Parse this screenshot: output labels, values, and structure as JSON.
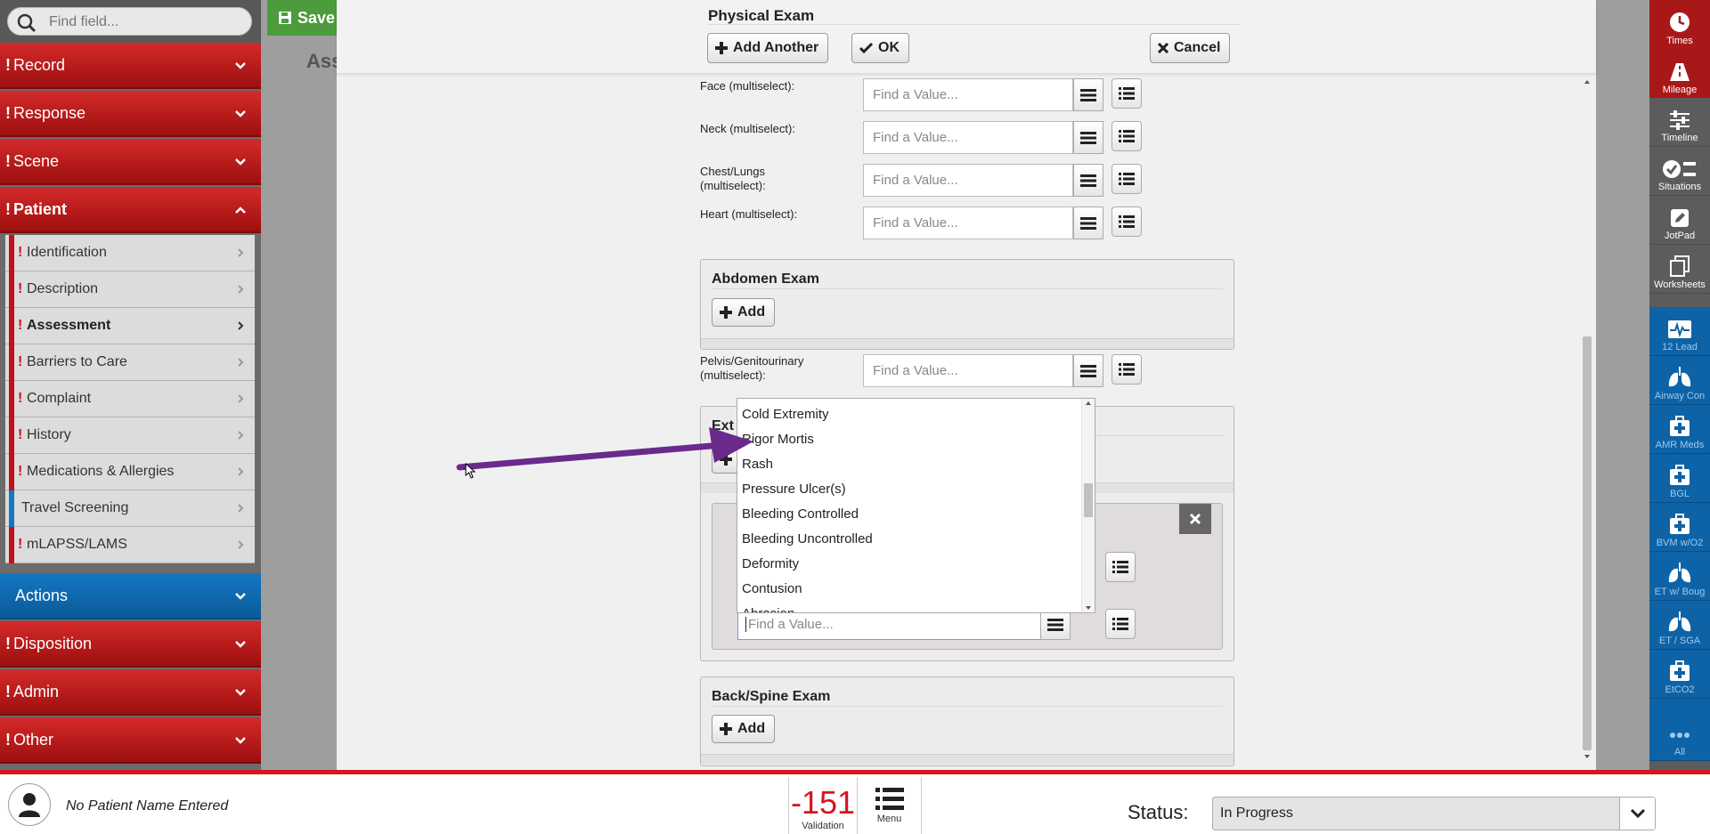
{
  "sidebar": {
    "search_placeholder": "Find field...",
    "sections": [
      {
        "label": "Record",
        "required": true
      },
      {
        "label": "Response",
        "required": true
      },
      {
        "label": "Scene",
        "required": true
      },
      {
        "label": "Patient",
        "required": true,
        "expanded": true
      }
    ],
    "patient_items": [
      {
        "label": "Identification",
        "required": true
      },
      {
        "label": "Description",
        "required": true
      },
      {
        "label": "Assessment",
        "required": true,
        "active": true
      },
      {
        "label": "Barriers to Care",
        "required": true
      },
      {
        "label": "Complaint",
        "required": true
      },
      {
        "label": "History",
        "required": true
      },
      {
        "label": "Medications & Allergies",
        "required": true
      },
      {
        "label": "Travel Screening",
        "required": false
      },
      {
        "label": "mLAPSS/LAMS",
        "required": true
      }
    ],
    "lower_sections": [
      {
        "label": "Actions",
        "required": false
      },
      {
        "label": "Disposition",
        "required": true
      },
      {
        "label": "Admin",
        "required": true
      },
      {
        "label": "Other",
        "required": true
      }
    ],
    "required_mark": "!"
  },
  "background": {
    "save_label": "Save",
    "page_title_partial": "Ass"
  },
  "modal": {
    "title": "Physical Exam",
    "add_another_label": "Add Another",
    "ok_label": "OK",
    "cancel_label": "Cancel",
    "fields": [
      {
        "label": "Face (multiselect):",
        "placeholder": "Find a Value..."
      },
      {
        "label": "Neck (multiselect):",
        "placeholder": "Find a Value..."
      },
      {
        "label": "Chest/Lungs (multiselect):",
        "placeholder": "Find a Value..."
      },
      {
        "label": "Heart (multiselect):",
        "placeholder": "Find a Value..."
      }
    ],
    "abdomen": {
      "title": "Abdomen Exam",
      "add_label": "Add"
    },
    "pelvis": {
      "label": "Pelvis/Genitourinary (multiselect):",
      "placeholder": "Find a Value..."
    },
    "extremity": {
      "title_partial": "Ext",
      "input_placeholder": "Find a Value..."
    },
    "back": {
      "title": "Back/Spine Exam",
      "add_label": "Add"
    },
    "dropdown_options": [
      "Cold Extremity",
      "Rigor Mortis",
      "Rash",
      "Pressure Ulcer(s)",
      "Bleeding Controlled",
      "Bleeding Uncontrolled",
      "Deformity",
      "Contusion",
      "Abrasion"
    ]
  },
  "rail": [
    {
      "label": "Times",
      "icon": "clock-icon"
    },
    {
      "label": "Mileage",
      "icon": "road-icon"
    },
    {
      "label": "Timeline",
      "icon": "sliders-icon"
    },
    {
      "label": "Situations",
      "icon": "check-circle-icon"
    },
    {
      "label": "JotPad",
      "icon": "pencil-icon"
    },
    {
      "label": "Worksheets",
      "icon": "copy-icon"
    },
    {
      "label": "12 Lead",
      "icon": "ekg-icon"
    },
    {
      "label": "Airway Con",
      "icon": "lungs-icon"
    },
    {
      "label": "AMR Meds",
      "icon": "medkit-icon"
    },
    {
      "label": "BGL",
      "icon": "medkit-icon"
    },
    {
      "label": "BVM w/O2",
      "icon": "medkit-icon"
    },
    {
      "label": "ET w/ Boug",
      "icon": "lungs-icon"
    },
    {
      "label": "ET / SGA",
      "icon": "lungs-icon"
    },
    {
      "label": "EtCO2",
      "icon": "medkit-icon"
    },
    {
      "label": "All",
      "icon": "ellipsis-icon"
    }
  ],
  "bottom": {
    "patient_name": "No Patient Name Entered",
    "validation_count": "-151",
    "validation_label": "Validation",
    "menu_label": "Menu",
    "status_label": "Status:",
    "status_value": "In Progress"
  },
  "colors": {
    "accent_red": "#d7141f",
    "section_red": "#b81c1c",
    "actions_blue": "#0a6bb8",
    "save_green": "#4c9b3c",
    "annotation_arrow": "#6a2a8c"
  }
}
